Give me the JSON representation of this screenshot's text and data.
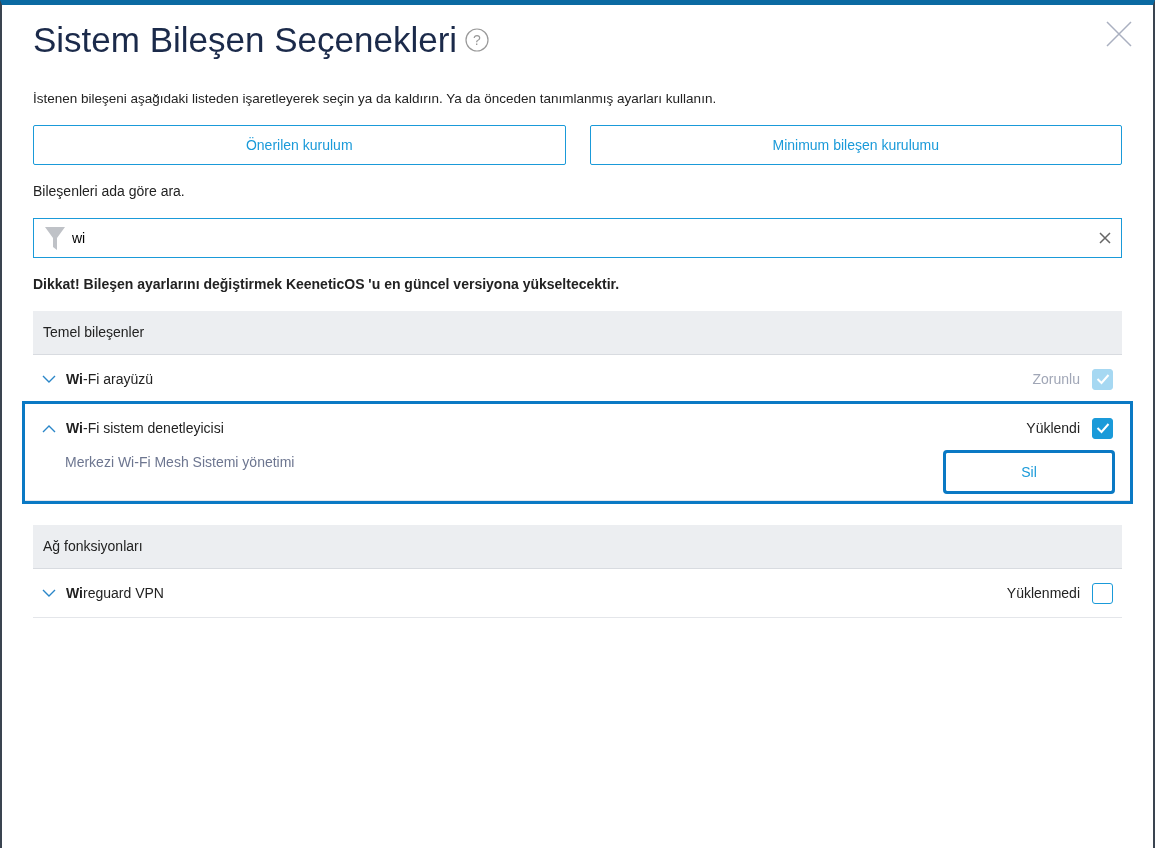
{
  "dialog": {
    "title": "Sistem Bileşen Seçenekleri",
    "help": "?",
    "intro": "İstenen bileşeni aşağıdaki listeden işaretleyerek seçin ya da kaldırın. Ya da önceden tanımlanmış ayarları kullanın.",
    "presets": [
      "Önerilen kurulum",
      "Minimum bileşen kurulumu"
    ],
    "search": {
      "label": "Bileşenleri ada göre ara.",
      "value": "wi"
    },
    "warning": "Dikkat! Bileşen ayarlarını değiştirmek KeeneticOS 'u en güncel versiyona yükseltecektir.",
    "groups": [
      {
        "title": "Temel bileşenler",
        "items": [
          {
            "name": "**Wi**-Fi arayüzü",
            "status": "Zorunlu",
            "checked": true,
            "disabled": true,
            "expanded": false,
            "highlighted": false
          },
          {
            "name": "**Wi**-Fi sistem denetleyicisi",
            "status": "Yüklendi",
            "checked": true,
            "disabled": false,
            "expanded": true,
            "highlighted": true,
            "description": "Merkezi Wi-Fi Mesh Sistemi yönetimi",
            "button": "Sil"
          }
        ]
      },
      {
        "title": "Ağ fonksiyonları",
        "items": [
          {
            "name": "**Wi**reguard VPN",
            "status": "Yüklenmedi",
            "checked": false,
            "disabled": false,
            "expanded": false,
            "highlighted": false
          }
        ]
      }
    ]
  }
}
